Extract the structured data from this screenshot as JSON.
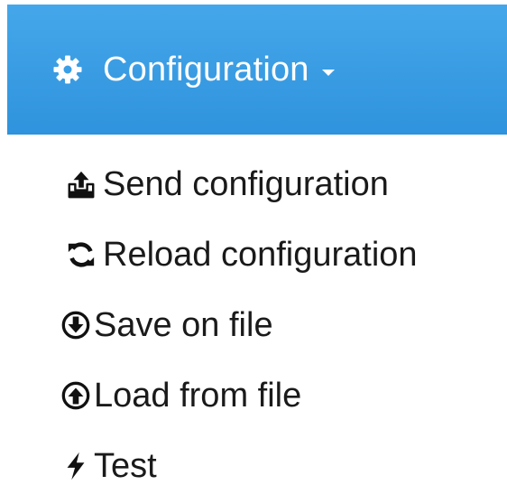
{
  "header": {
    "title": "Configuration",
    "icon": "gear-icon",
    "background_color": "#3a9fe6",
    "text_color": "#ffffff"
  },
  "menu": {
    "items": [
      {
        "label": "Send configuration",
        "icon": "upload-tray-icon"
      },
      {
        "label": "Reload configuration",
        "icon": "refresh-icon"
      },
      {
        "label": "Save on file",
        "icon": "arrow-circle-down-icon"
      },
      {
        "label": "Load from file",
        "icon": "arrow-circle-up-icon"
      },
      {
        "label": "Test",
        "icon": "bolt-icon"
      }
    ]
  }
}
